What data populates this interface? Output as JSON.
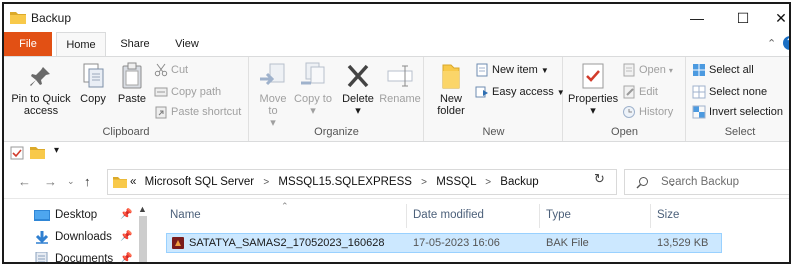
{
  "window": {
    "title": "Backup",
    "min_glyph": "—",
    "max_glyph": "☐",
    "close_glyph": "✕"
  },
  "ribbon_tabs": [
    "File",
    "Home",
    "Share",
    "View"
  ],
  "ribbon": {
    "clipboard": {
      "label": "Clipboard",
      "pin": "Pin to Quick access",
      "copy": "Copy",
      "paste": "Paste",
      "cut": "Cut",
      "copy_path": "Copy path",
      "paste_shortcut": "Paste shortcut"
    },
    "organize": {
      "label": "Organize",
      "move_to": "Move to",
      "copy_to": "Copy to",
      "delete": "Delete",
      "rename": "Rename"
    },
    "new": {
      "label": "New",
      "new_folder": "New folder",
      "new_item": "New item",
      "easy_access": "Easy access"
    },
    "open": {
      "label": "Open",
      "properties": "Properties",
      "open": "Open",
      "edit": "Edit",
      "history": "History"
    },
    "select": {
      "label": "Select",
      "select_all": "Select all",
      "select_none": "Select none",
      "invert_selection": "Invert selection"
    }
  },
  "address": {
    "breadcrumb": [
      "Microsoft SQL Server",
      "MSSQL15.SQLEXPRESS",
      "MSSQL",
      "Backup"
    ],
    "overflow": "«"
  },
  "search": {
    "placeholder": "Search Backup"
  },
  "nav_pane": {
    "items": [
      {
        "label": "Desktop",
        "icon": "desktop-icon"
      },
      {
        "label": "Downloads",
        "icon": "downloads-icon"
      },
      {
        "label": "Documents",
        "icon": "documents-icon"
      }
    ]
  },
  "file_list": {
    "columns": [
      "Name",
      "Date modified",
      "Type",
      "Size"
    ],
    "rows": [
      {
        "name": "SATATYA_SAMAS2_17052023_160628",
        "date": "17-05-2023 16:06",
        "type": "BAK File",
        "size": "13,529 KB"
      }
    ]
  },
  "colors": {
    "file_tab": "#e25014",
    "selection": "#cce8ff",
    "folder": "#f8c94a",
    "accent": "#1a6fc4"
  }
}
